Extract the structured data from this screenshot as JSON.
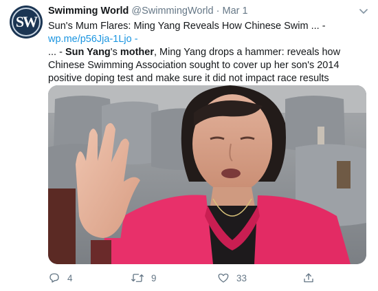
{
  "tweet": {
    "avatar_text": "SW",
    "display_name": "Swimming World",
    "handle": "@SwimmingWorld",
    "separator": "·",
    "time": "Mar 1",
    "text_line1": "Sun's Mum Flares: Ming Yang Reveals How Chinese Swim ... -",
    "link": "wp.me/p56Jja-1Ljo",
    "link_suffix": " -",
    "text_prefix": " ... - ",
    "bold_name": "Sun Yang",
    "text_mid": "'s ",
    "bold_mother": "mother",
    "text_rest": ", Ming Yang drops a hammer: reveals how Chinese Swimming Association sought to cover up her son's 2014 positive doping test and make sure it did not impact race results",
    "media_alt": "Photo of a woman in a pink cardigan raising her hand while speaking",
    "counts": {
      "replies": "4",
      "retweets": "9",
      "likes": "33"
    }
  },
  "colors": {
    "link": "#1b95e0",
    "muted": "#657786",
    "cardigan": "#e8306a"
  },
  "icons": [
    "chevron-down-icon",
    "reply-icon",
    "retweet-icon",
    "like-icon",
    "share-icon"
  ]
}
